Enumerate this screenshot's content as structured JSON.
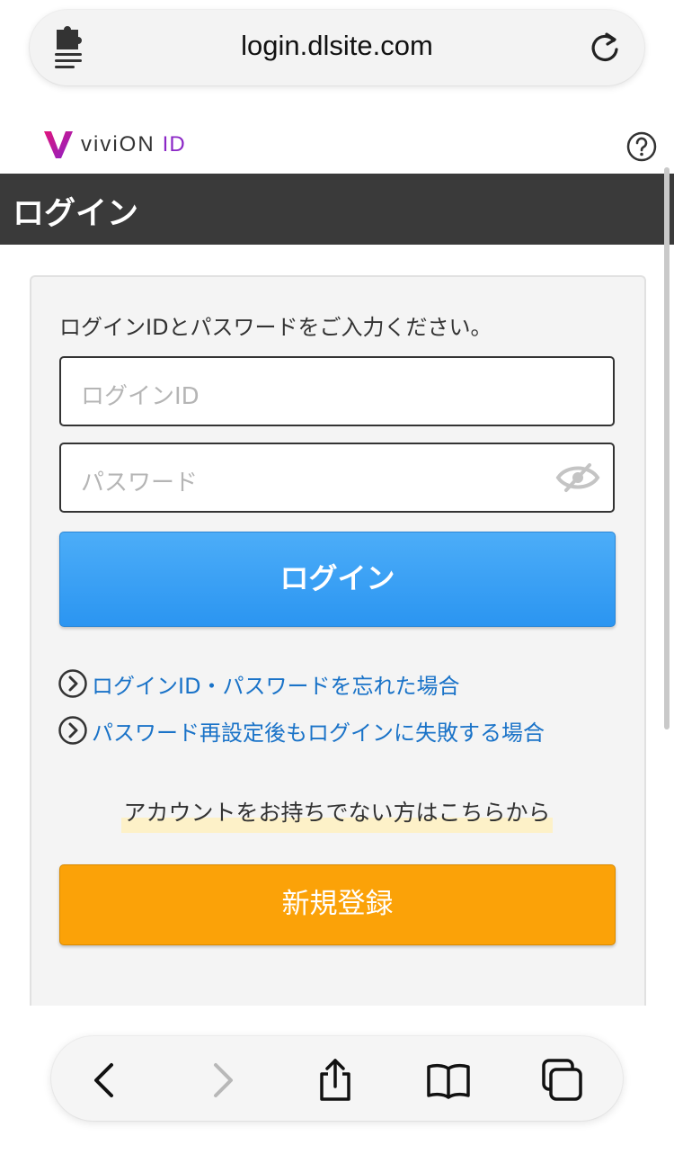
{
  "browser": {
    "url": "login.dlsite.com",
    "icons": {
      "extension": "puzzle-menu-icon",
      "reload": "reload-icon"
    }
  },
  "site": {
    "brand_name": "viviON",
    "brand_suffix": "ID",
    "help_icon": "question-circle-icon",
    "page_title": "ログイン"
  },
  "form": {
    "instruction": "ログインIDとパスワードをご入力ください。",
    "login_id_placeholder": "ログインID",
    "password_placeholder": "パスワード",
    "login_button": "ログイン",
    "links": [
      {
        "label": "ログインID・パスワードを忘れた場合"
      },
      {
        "label": "パスワード再設定後もログインに失敗する場合"
      }
    ],
    "no_account_text": "アカウントをお持ちでない方はこちらから",
    "register_button": "新規登録"
  },
  "toolbar": {
    "items": [
      "back-icon",
      "forward-icon",
      "share-icon",
      "bookmarks-icon",
      "tabs-icon"
    ]
  },
  "colors": {
    "title_bar": "#3a3a3a",
    "login_button": "#2b95f1",
    "register_button": "#fba208",
    "link": "#1a73c8",
    "brand_accent": "#8b27c6"
  }
}
